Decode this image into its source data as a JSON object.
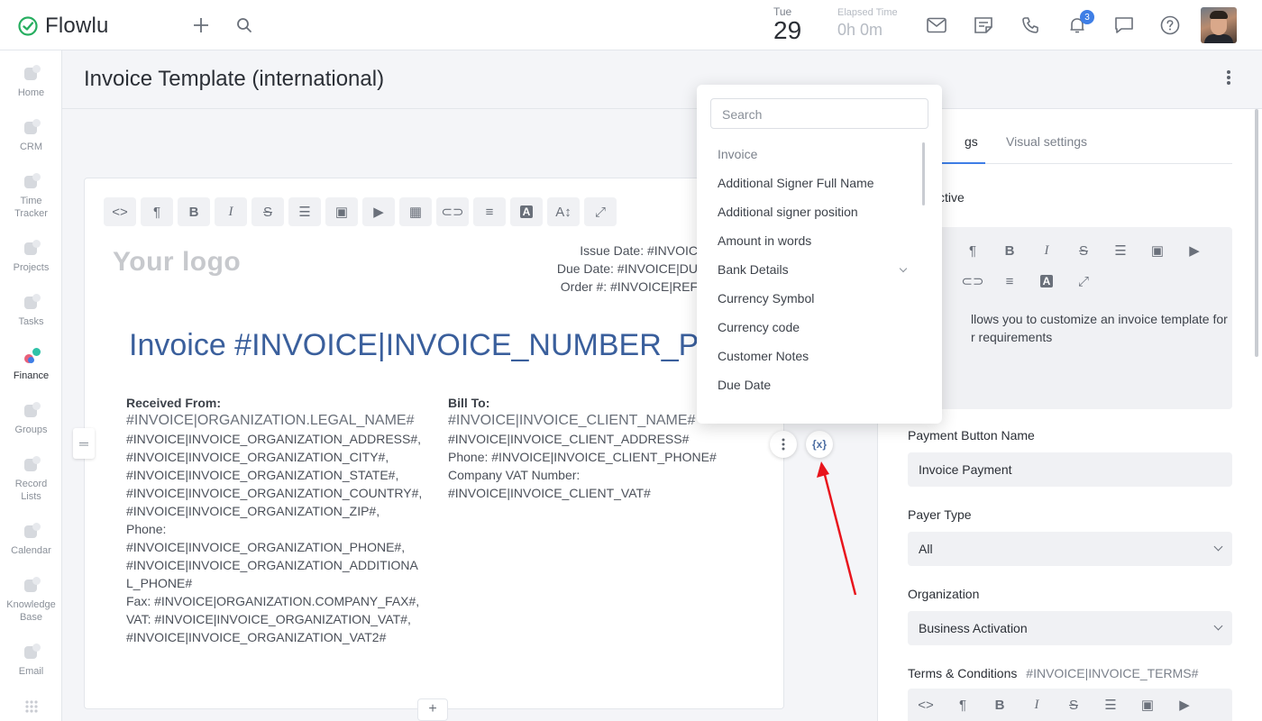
{
  "app": {
    "name": "Flowlu",
    "accent": "#3e7ee6",
    "logo_color": "#27ae60"
  },
  "topbar": {
    "date_day": "Tue",
    "date_num": "29",
    "elapsed_label": "Elapsed Time",
    "elapsed_value": "0h 0m",
    "notifications_count": "3",
    "icons": [
      "plus-icon",
      "search-icon",
      "mail-icon",
      "notes-icon",
      "phone-icon",
      "bell-icon",
      "chat-icon",
      "help-icon"
    ]
  },
  "sidebar": {
    "items": [
      {
        "label": "Home"
      },
      {
        "label": "CRM"
      },
      {
        "label": "Time Tracker"
      },
      {
        "label": "Projects"
      },
      {
        "label": "Tasks"
      },
      {
        "label": "Finance"
      },
      {
        "label": "Groups"
      },
      {
        "label": "Record Lists"
      },
      {
        "label": "Calendar"
      },
      {
        "label": "Knowledge Base"
      },
      {
        "label": "Email"
      }
    ]
  },
  "page": {
    "title": "Invoice Template (international)"
  },
  "editor": {
    "your_logo": "Your logo",
    "issue_date": "Issue Date: #INVOIC",
    "due_date": "Due Date: #INVOICE|DU",
    "order": "Order #: #INVOICE|REF",
    "invoice_heading": "Invoice #INVOICE|INVOICE_NUMBER_PRIN",
    "received_from": {
      "heading": "Received From:",
      "legal_name": "#INVOICE|ORGANIZATION.LEGAL_NAME#",
      "lines": [
        "#INVOICE|INVOICE_ORGANIZATION_ADDRESS#,",
        "#INVOICE|INVOICE_ORGANIZATION_CITY#,",
        "#INVOICE|INVOICE_ORGANIZATION_STATE#,",
        "#INVOICE|INVOICE_ORGANIZATION_COUNTRY#,",
        "#INVOICE|INVOICE_ORGANIZATION_ZIP#,",
        "Phone:",
        "#INVOICE|INVOICE_ORGANIZATION_PHONE#,",
        "#INVOICE|INVOICE_ORGANIZATION_ADDITIONA",
        "L_PHONE#",
        "Fax: #INVOICE|ORGANIZATION.COMPANY_FAX#,",
        "VAT: #INVOICE|INVOICE_ORGANIZATION_VAT#,",
        "#INVOICE|INVOICE_ORGANIZATION_VAT2#"
      ]
    },
    "bill_to": {
      "heading": "Bill To:",
      "client_name": "#INVOICE|INVOICE_CLIENT_NAME#",
      "lines": [
        "#INVOICE|INVOICE_CLIENT_ADDRESS#",
        "Phone: #INVOICE|INVOICE_CLIENT_PHONE#",
        "Company VAT Number:",
        "#INVOICE|INVOICE_CLIENT_VAT#"
      ]
    },
    "variables_button": "{x}",
    "add_button": "+"
  },
  "dropdown": {
    "search_placeholder": "Search",
    "items": [
      {
        "label": "Invoice",
        "group": true
      },
      {
        "label": "Additional Signer Full Name"
      },
      {
        "label": "Additional signer position"
      },
      {
        "label": "Amount in words"
      },
      {
        "label": "Bank Details",
        "expandable": true
      },
      {
        "label": "Currency Symbol"
      },
      {
        "label": "Currency code"
      },
      {
        "label": "Customer Notes"
      },
      {
        "label": "Due Date"
      }
    ]
  },
  "right_panel": {
    "tab_settings": "gs",
    "tab_visual": "Visual settings",
    "active_label": "ctive",
    "description_text": "llows you to customize an invoice template for\nr requirements",
    "payment_button_label": "Payment Button Name",
    "payment_button_value": "Invoice Payment",
    "payer_type_label": "Payer Type",
    "payer_type_value": "All",
    "organization_label": "Organization",
    "organization_value": "Business Activation",
    "terms_label": "Terms & Conditions",
    "terms_variable": "#INVOICE|INVOICE_TERMS#"
  }
}
